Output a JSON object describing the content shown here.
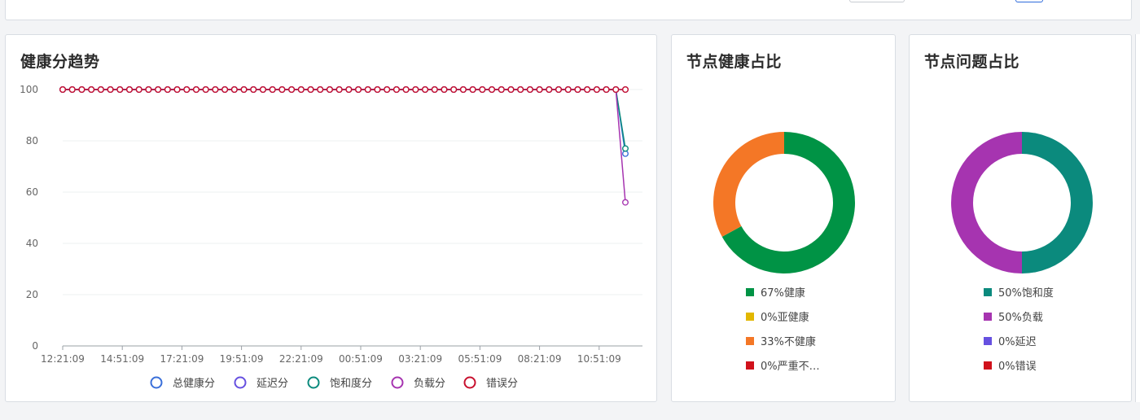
{
  "line_card": {
    "title": "健康分趋势",
    "legend": [
      {
        "label": "总健康分",
        "color": "#3a6fd9"
      },
      {
        "label": "延迟分",
        "color": "#6650e0"
      },
      {
        "label": "饱和度分",
        "color": "#0b8a7d"
      },
      {
        "label": "负载分",
        "color": "#a634b0"
      },
      {
        "label": "错误分",
        "color": "#c8102e"
      }
    ]
  },
  "donut_health": {
    "title": "节点健康占比",
    "legend": [
      {
        "label": "67%健康",
        "color": "#009345",
        "value": 67
      },
      {
        "label": "0%亚健康",
        "color": "#e2b700",
        "value": 0
      },
      {
        "label": "33%不健康",
        "color": "#f47726",
        "value": 33
      },
      {
        "label": "0%严重不…",
        "color": "#d0111b",
        "value": 0
      }
    ]
  },
  "donut_issue": {
    "title": "节点问题占比",
    "legend": [
      {
        "label": "50%饱和度",
        "color": "#0b8a7d",
        "value": 50
      },
      {
        "label": "50%负载",
        "color": "#a634b0",
        "value": 50
      },
      {
        "label": "0%延迟",
        "color": "#6650e0",
        "value": 0
      },
      {
        "label": "0%错误",
        "color": "#d0111b",
        "value": 0
      }
    ]
  },
  "chart_data": [
    {
      "type": "line",
      "title": "健康分趋势",
      "ylim": [
        0,
        100
      ],
      "yticks": [
        0,
        20,
        40,
        60,
        80,
        100
      ],
      "xtick_labels": [
        "12:21:09",
        "14:51:09",
        "17:21:09",
        "19:51:09",
        "22:21:09",
        "00:51:09",
        "03:21:09",
        "05:51:09",
        "08:21:09",
        "10:51:09"
      ],
      "x_count": 60,
      "series": [
        {
          "name": "总健康分",
          "color": "#3a6fd9",
          "values": [
            100,
            100,
            100,
            100,
            100,
            100,
            100,
            100,
            100,
            100,
            100,
            100,
            100,
            100,
            100,
            100,
            100,
            100,
            100,
            100,
            100,
            100,
            100,
            100,
            100,
            100,
            100,
            100,
            100,
            100,
            100,
            100,
            100,
            100,
            100,
            100,
            100,
            100,
            100,
            100,
            100,
            100,
            100,
            100,
            100,
            100,
            100,
            100,
            100,
            100,
            100,
            100,
            100,
            100,
            100,
            100,
            100,
            100,
            100,
            75
          ]
        },
        {
          "name": "延迟分",
          "color": "#6650e0",
          "values": [
            100,
            100,
            100,
            100,
            100,
            100,
            100,
            100,
            100,
            100,
            100,
            100,
            100,
            100,
            100,
            100,
            100,
            100,
            100,
            100,
            100,
            100,
            100,
            100,
            100,
            100,
            100,
            100,
            100,
            100,
            100,
            100,
            100,
            100,
            100,
            100,
            100,
            100,
            100,
            100,
            100,
            100,
            100,
            100,
            100,
            100,
            100,
            100,
            100,
            100,
            100,
            100,
            100,
            100,
            100,
            100,
            100,
            100,
            100,
            100
          ]
        },
        {
          "name": "饱和度分",
          "color": "#0b8a7d",
          "values": [
            100,
            100,
            100,
            100,
            100,
            100,
            100,
            100,
            100,
            100,
            100,
            100,
            100,
            100,
            100,
            100,
            100,
            100,
            100,
            100,
            100,
            100,
            100,
            100,
            100,
            100,
            100,
            100,
            100,
            100,
            100,
            100,
            100,
            100,
            100,
            100,
            100,
            100,
            100,
            100,
            100,
            100,
            100,
            100,
            100,
            100,
            100,
            100,
            100,
            100,
            100,
            100,
            100,
            100,
            100,
            100,
            100,
            100,
            100,
            77
          ]
        },
        {
          "name": "负载分",
          "color": "#a634b0",
          "values": [
            100,
            100,
            100,
            100,
            100,
            100,
            100,
            100,
            100,
            100,
            100,
            100,
            100,
            100,
            100,
            100,
            100,
            100,
            100,
            100,
            100,
            100,
            100,
            100,
            100,
            100,
            100,
            100,
            100,
            100,
            100,
            100,
            100,
            100,
            100,
            100,
            100,
            100,
            100,
            100,
            100,
            100,
            100,
            100,
            100,
            100,
            100,
            100,
            100,
            100,
            100,
            100,
            100,
            100,
            100,
            100,
            100,
            100,
            100,
            56
          ]
        },
        {
          "name": "错误分",
          "color": "#c8102e",
          "values": [
            100,
            100,
            100,
            100,
            100,
            100,
            100,
            100,
            100,
            100,
            100,
            100,
            100,
            100,
            100,
            100,
            100,
            100,
            100,
            100,
            100,
            100,
            100,
            100,
            100,
            100,
            100,
            100,
            100,
            100,
            100,
            100,
            100,
            100,
            100,
            100,
            100,
            100,
            100,
            100,
            100,
            100,
            100,
            100,
            100,
            100,
            100,
            100,
            100,
            100,
            100,
            100,
            100,
            100,
            100,
            100,
            100,
            100,
            100,
            100
          ]
        }
      ],
      "legend_position": "bottom",
      "grid": true
    },
    {
      "type": "pie",
      "title": "节点健康占比",
      "categories": [
        "健康",
        "亚健康",
        "不健康",
        "严重不…"
      ],
      "values": [
        67,
        0,
        33,
        0
      ],
      "colors": [
        "#009345",
        "#e2b700",
        "#f47726",
        "#d0111b"
      ],
      "legend_position": "bottom"
    },
    {
      "type": "pie",
      "title": "节点问题占比",
      "categories": [
        "饱和度",
        "负载",
        "延迟",
        "错误"
      ],
      "values": [
        50,
        50,
        0,
        0
      ],
      "colors": [
        "#0b8a7d",
        "#a634b0",
        "#6650e0",
        "#d0111b"
      ],
      "legend_position": "bottom"
    }
  ]
}
